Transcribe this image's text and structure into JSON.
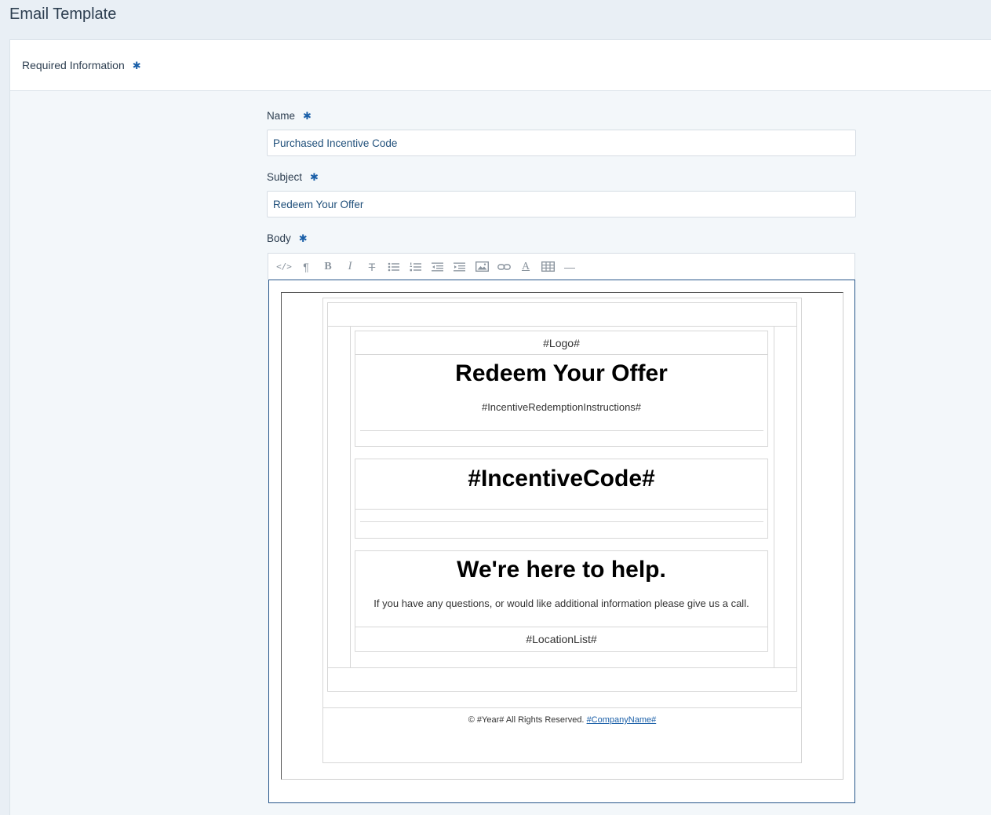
{
  "page": {
    "title": "Email Template"
  },
  "section": {
    "title": "Required Information",
    "required_mark": "✱"
  },
  "form": {
    "name": {
      "label": "Name",
      "value": "Purchased Incentive Code"
    },
    "subject": {
      "label": "Subject",
      "value": "Redeem Your Offer"
    },
    "body": {
      "label": "Body"
    }
  },
  "toolbar": {
    "icons": [
      "code-view-icon",
      "paragraph-icon",
      "bold-icon",
      "italic-icon",
      "strikethrough-icon",
      "unordered-list-icon",
      "ordered-list-icon",
      "outdent-icon",
      "indent-icon",
      "image-icon",
      "link-icon",
      "text-color-icon",
      "table-icon",
      "horizontal-rule-icon"
    ],
    "code_label": "</>",
    "paragraph_label": "¶",
    "bold_label": "B",
    "italic_label": "I",
    "strike_label": "T",
    "color_label": "A",
    "hr_label": "—"
  },
  "email_preview": {
    "logo": "#Logo#",
    "heading": "Redeem Your Offer",
    "instructions": "#IncentiveRedemptionInstructions#",
    "incentive_code": "#IncentiveCode#",
    "help_heading": "We're here to help.",
    "help_text": "If you have any questions, or would like additional information please give us a call.",
    "location_list": "#LocationList#",
    "footer_prefix": "© #Year# All Rights Reserved.",
    "footer_company": "#CompanyName#"
  },
  "colors": {
    "accent": "#1a5fa8",
    "editor_border": "#27568a",
    "background": "#e9eff5"
  }
}
